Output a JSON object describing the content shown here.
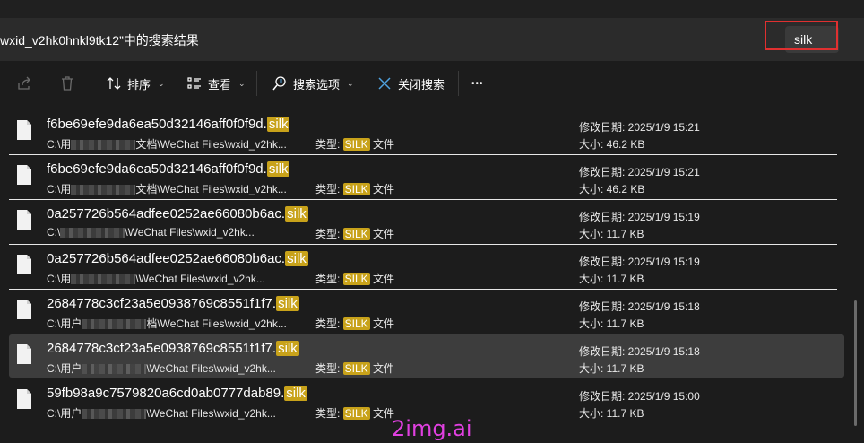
{
  "address": {
    "text": "wxid_v2hk0hnkl9tk12”中的搜索结果"
  },
  "search": {
    "value": "silk"
  },
  "toolbar": {
    "sort_label": "排序",
    "view_label": "查看",
    "search_options_label": "搜索选项",
    "close_search_label": "关闭搜索",
    "more_label": "•••"
  },
  "files": [
    {
      "name": "f6be69efe9da6ea50d32146aff0f0f9d.",
      "ext": "silk",
      "path_prefix": "C:\\用",
      "path_suffix": "文档\\WeChat Files\\wxid_v2hk...",
      "type_prefix": "类型: ",
      "type_hl": "SILK",
      "type_suffix": " 文件",
      "date": "修改日期: 2025/1/9 15:21",
      "size": "大小: 46.2 KB"
    },
    {
      "name": "f6be69efe9da6ea50d32146aff0f0f9d.",
      "ext": "silk",
      "path_prefix": "C:\\用",
      "path_suffix": "文档\\WeChat Files\\wxid_v2hk...",
      "type_prefix": "类型: ",
      "type_hl": "SILK",
      "type_suffix": " 文件",
      "date": "修改日期: 2025/1/9 15:21",
      "size": "大小: 46.2 KB"
    },
    {
      "name": "0a257726b564adfee0252ae66080b6ac.",
      "ext": "silk",
      "path_prefix": "C:\\",
      "path_suffix": "\\WeChat Files\\wxid_v2hk...",
      "type_prefix": "类型: ",
      "type_hl": "SILK",
      "type_suffix": " 文件",
      "date": "修改日期: 2025/1/9 15:19",
      "size": "大小: 11.7 KB"
    },
    {
      "name": "0a257726b564adfee0252ae66080b6ac.",
      "ext": "silk",
      "path_prefix": "C:\\用",
      "path_suffix": "\\WeChat Files\\wxid_v2hk...",
      "type_prefix": "类型: ",
      "type_hl": "SILK",
      "type_suffix": " 文件",
      "date": "修改日期: 2025/1/9 15:19",
      "size": "大小: 11.7 KB"
    },
    {
      "name": "2684778c3cf23a5e0938769c8551f1f7.",
      "ext": "silk",
      "path_prefix": "C:\\用户",
      "path_suffix": "档\\WeChat Files\\wxid_v2hk...",
      "type_prefix": "类型: ",
      "type_hl": "SILK",
      "type_suffix": " 文件",
      "date": "修改日期: 2025/1/9 15:18",
      "size": "大小: 11.7 KB"
    },
    {
      "name": "2684778c3cf23a5e0938769c8551f1f7.",
      "ext": "silk",
      "path_prefix": "C:\\用户",
      "path_suffix": "\\WeChat Files\\wxid_v2hk...",
      "type_prefix": "类型: ",
      "type_hl": "SILK",
      "type_suffix": " 文件",
      "date": "修改日期: 2025/1/9 15:18",
      "size": "大小: 11.7 KB"
    },
    {
      "name": "59fb98a9c7579820a6cd0ab0777dab89.",
      "ext": "silk",
      "path_prefix": "C:\\用户",
      "path_suffix": "\\WeChat Files\\wxid_v2hk...",
      "type_prefix": "类型: ",
      "type_hl": "SILK",
      "type_suffix": " 文件",
      "date": "修改日期: 2025/1/9 15:00",
      "size": "大小: 11.7 KB"
    }
  ],
  "watermark": "2img.ai"
}
